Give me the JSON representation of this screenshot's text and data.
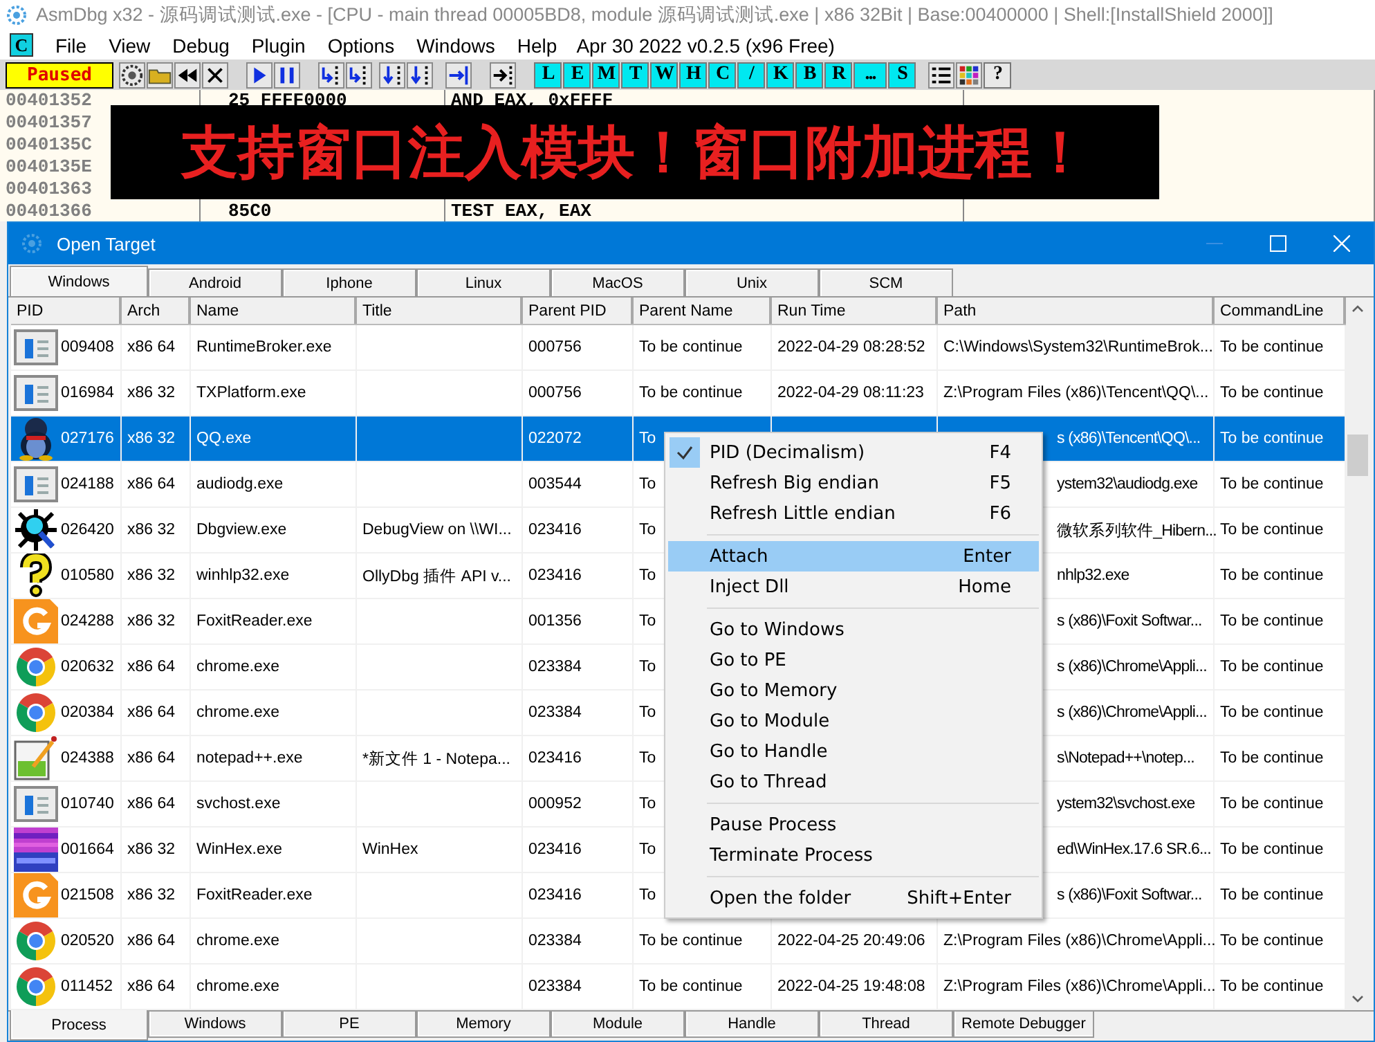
{
  "window": {
    "title": "AsmDbg x32 - 源码调试测试.exe - [CPU - main thread 00005BD8, module 源码调试测试.exe | x86 32Bit | Base:00400000 | Shell:[InstallShield 2000]]"
  },
  "menu": {
    "logo": "C",
    "items": [
      "File",
      "View",
      "Debug",
      "Plugin",
      "Options",
      "Windows",
      "Help"
    ],
    "build": "Apr 30 2022  v0.2.5 (x96 Free)"
  },
  "toolbar": {
    "status": "Paused",
    "letters": [
      "L",
      "E",
      "M",
      "T",
      "W",
      "H",
      "C",
      "/",
      "K",
      "B",
      "R",
      "...",
      "S"
    ],
    "help": "?"
  },
  "disassembly": [
    {
      "address": "00401352",
      "bytes": "25 FFFF0000",
      "instruction": "AND EAX, 0xFFFF"
    },
    {
      "address": "00401357"
    },
    {
      "address": "0040135C"
    },
    {
      "address": "0040135E"
    },
    {
      "address": "00401363"
    },
    {
      "address": "00401366",
      "bytes": "85C0",
      "instruction": "TEST EAX, EAX"
    }
  ],
  "banner": "支持窗口注入模块！窗口附加进程！",
  "dialog": {
    "title": "Open Target",
    "tabs": [
      {
        "label": "Windows",
        "selected": true
      },
      {
        "label": "Android",
        "selected": false
      },
      {
        "label": "Iphone",
        "selected": false
      },
      {
        "label": "Linux",
        "selected": false
      },
      {
        "label": "MacOS",
        "selected": false
      },
      {
        "label": "Unix",
        "selected": false
      },
      {
        "label": "SCM",
        "selected": false
      }
    ],
    "columns": [
      "PID",
      "Arch",
      "Name",
      "Title",
      "Parent PID",
      "Parent Name",
      "Run Time",
      "Path",
      "CommandLine"
    ],
    "rows": [
      {
        "kind": "window",
        "pid": "009408",
        "arch": "x86 64",
        "name": "RuntimeBroker.exe",
        "parent_pid": "000756",
        "parent_name": "To be continue",
        "run_time": "2022-04-29 08:28:52",
        "path": "C:\\Windows\\System32\\RuntimeBrok...",
        "command_line": "To be continue",
        "selected": false
      },
      {
        "kind": "window",
        "pid": "016984",
        "arch": "x86 32",
        "name": "TXPlatform.exe",
        "parent_pid": "000756",
        "parent_name": "To be continue",
        "run_time": "2022-04-29 08:11:23",
        "path": "Z:\\Program Files (x86)\\Tencent\\QQ\\...",
        "command_line": "To be continue",
        "selected": false
      },
      {
        "kind": "penguin",
        "pid": "027176",
        "arch": "x86 32",
        "name": "QQ.exe",
        "parent_pid": "022072",
        "parent_name": "To",
        "path_tail": "s (x86)\\Tencent\\QQ\\...",
        "command_line": "To be continue",
        "selected": true
      },
      {
        "kind": "window",
        "pid": "024188",
        "arch": "x86 64",
        "name": "audiodg.exe",
        "parent_pid": "003544",
        "parent_name": "To",
        "path_tail": "ystem32\\audiodg.exe",
        "command_line": "To be continue",
        "selected": false
      },
      {
        "kind": "bug",
        "pid": "026420",
        "arch": "x86 32",
        "name": "Dbgview.exe",
        "title": "DebugView on \\\\WI...",
        "parent_pid": "023416",
        "parent_name": "To",
        "path_tail": "微软系列软件_Hibern...",
        "command_line": "To be continue",
        "selected": false
      },
      {
        "kind": "question",
        "pid": "010580",
        "arch": "x86 32",
        "name": "winhlp32.exe",
        "title": "OllyDbg 插件 API v...",
        "parent_pid": "023416",
        "parent_name": "To",
        "path_tail": "nhlp32.exe",
        "command_line": "To be continue",
        "selected": false
      },
      {
        "kind": "foxit",
        "pid": "024288",
        "arch": "x86 32",
        "name": "FoxitReader.exe",
        "parent_pid": "001356",
        "parent_name": "To",
        "path_tail": "s (x86)\\Foxit Softwar...",
        "command_line": "To be continue",
        "selected": false
      },
      {
        "kind": "chrome",
        "pid": "020632",
        "arch": "x86 64",
        "name": "chrome.exe",
        "parent_pid": "023384",
        "parent_name": "To",
        "path_tail": "s (x86)\\Chrome\\Appli...",
        "command_line": "To be continue",
        "selected": false
      },
      {
        "kind": "chrome",
        "pid": "020384",
        "arch": "x86 64",
        "name": "chrome.exe",
        "parent_pid": "023384",
        "parent_name": "To",
        "path_tail": "s (x86)\\Chrome\\Appli...",
        "command_line": "To be continue",
        "selected": false
      },
      {
        "kind": "notepad",
        "pid": "024388",
        "arch": "x86 64",
        "name": "notepad++.exe",
        "title": "*新文件 1 - Notepa...",
        "parent_pid": "023416",
        "parent_name": "To",
        "path_tail": "s\\Notepad++\\notep...",
        "command_line": "To be continue",
        "selected": false
      },
      {
        "kind": "window",
        "pid": "010740",
        "arch": "x86 64",
        "name": "svchost.exe",
        "parent_pid": "000952",
        "parent_name": "To",
        "path_tail": "ystem32\\svchost.exe",
        "command_line": "To be continue",
        "selected": false
      },
      {
        "kind": "hex",
        "pid": "001664",
        "arch": "x86 32",
        "name": "WinHex.exe",
        "title": "WinHex",
        "parent_pid": "023416",
        "parent_name": "To",
        "path_tail": "ed\\WinHex.17.6 SR.6...",
        "command_line": "To be continue",
        "selected": false
      },
      {
        "kind": "foxit",
        "pid": "021508",
        "arch": "x86 32",
        "name": "FoxitReader.exe",
        "parent_pid": "023416",
        "parent_name": "To",
        "path_tail": "s (x86)\\Foxit Softwar...",
        "command_line": "To be continue",
        "selected": false
      },
      {
        "kind": "chrome",
        "pid": "020520",
        "arch": "x86 64",
        "name": "chrome.exe",
        "parent_pid": "023384",
        "parent_name": "To be continue",
        "run_time": "2022-04-25 20:49:06",
        "path": "Z:\\Program Files (x86)\\Chrome\\Appli...",
        "command_line": "To be continue",
        "selected": false
      },
      {
        "kind": "chrome",
        "pid": "011452",
        "arch": "x86 64",
        "name": "chrome.exe",
        "parent_pid": "023384",
        "parent_name": "To be continue",
        "run_time": "2022-04-25 19:48:08",
        "path": "Z:\\Program Files (x86)\\Chrome\\Appli...",
        "command_line": "To be continue",
        "selected": false
      }
    ],
    "context_menu": {
      "groups": [
        {
          "items": [
            {
              "label": "PID (Decimalism)",
              "shortcut": "F4",
              "checked": true,
              "selected": false
            },
            {
              "label": "Refresh Big endian",
              "shortcut": "F5",
              "checked": false,
              "selected": false
            },
            {
              "label": "Refresh Little endian",
              "shortcut": "F6",
              "checked": false,
              "selected": false
            }
          ]
        },
        {
          "items": [
            {
              "label": "Attach",
              "shortcut": "Enter",
              "checked": false,
              "selected": true
            },
            {
              "label": "Inject Dll",
              "shortcut": "Home",
              "checked": false,
              "selected": false
            }
          ]
        },
        {
          "items": [
            {
              "label": "Go to Windows",
              "checked": false,
              "selected": false
            },
            {
              "label": "Go to PE",
              "checked": false,
              "selected": false
            },
            {
              "label": "Go to Memory",
              "checked": false,
              "selected": false
            },
            {
              "label": "Go to Module",
              "checked": false,
              "selected": false
            },
            {
              "label": "Go to Handle",
              "checked": false,
              "selected": false
            },
            {
              "label": "Go to Thread",
              "checked": false,
              "selected": false
            }
          ]
        },
        {
          "items": [
            {
              "label": "Pause Process",
              "checked": false,
              "selected": false
            },
            {
              "label": "Terminate Process",
              "checked": false,
              "selected": false
            }
          ]
        },
        {
          "items": [
            {
              "label": "Open the folder",
              "shortcut": "Shift+Enter",
              "checked": false,
              "selected": false
            }
          ]
        }
      ]
    },
    "bottom_tabs": [
      {
        "label": "Process",
        "selected": true
      },
      {
        "label": "Windows",
        "selected": false
      },
      {
        "label": "PE",
        "selected": false
      },
      {
        "label": "Memory",
        "selected": false
      },
      {
        "label": "Module",
        "selected": false
      },
      {
        "label": "Handle",
        "selected": false
      },
      {
        "label": "Thread",
        "selected": false
      },
      {
        "label": "Remote Debugger",
        "selected": false
      }
    ]
  }
}
